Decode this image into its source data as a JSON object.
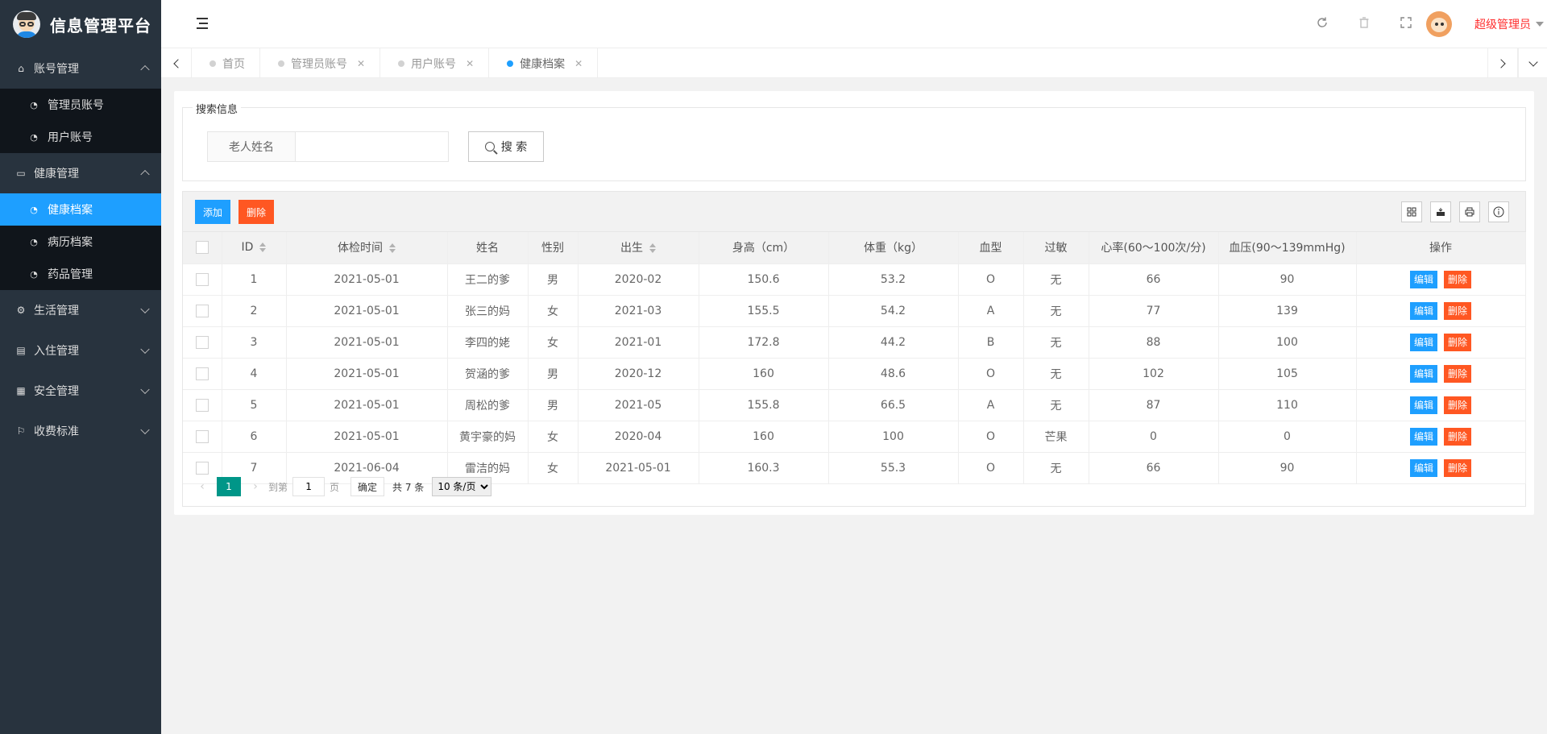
{
  "app": {
    "title": "信息管理平台"
  },
  "sidebar": {
    "groups": [
      {
        "label": "账号管理",
        "icon": "home-icon",
        "expanded": true,
        "items": [
          {
            "label": "管理员账号",
            "icon": "dashboard-icon",
            "active": false
          },
          {
            "label": "用户账号",
            "icon": "dashboard-icon",
            "active": false
          }
        ]
      },
      {
        "label": "健康管理",
        "icon": "window-icon",
        "expanded": true,
        "items": [
          {
            "label": "健康档案",
            "icon": "dashboard-icon",
            "active": true
          },
          {
            "label": "病历档案",
            "icon": "dashboard-icon",
            "active": false
          },
          {
            "label": "药品管理",
            "icon": "dashboard-icon",
            "active": false
          }
        ]
      },
      {
        "label": "生活管理",
        "icon": "gears-icon",
        "expanded": false,
        "items": []
      },
      {
        "label": "入住管理",
        "icon": "file-icon",
        "expanded": false,
        "items": []
      },
      {
        "label": "安全管理",
        "icon": "calendar-icon",
        "expanded": false,
        "items": []
      },
      {
        "label": "收费标准",
        "icon": "flag-icon",
        "expanded": false,
        "items": []
      }
    ]
  },
  "header": {
    "admin_name": "超级管理员",
    "icons": [
      "refresh-icon",
      "trash-icon",
      "fullscreen-icon"
    ]
  },
  "tabs": [
    {
      "label": "首页",
      "closable": false,
      "active": false
    },
    {
      "label": "管理员账号",
      "closable": true,
      "active": false
    },
    {
      "label": "用户账号",
      "closable": true,
      "active": false
    },
    {
      "label": "健康档案",
      "closable": true,
      "active": true
    }
  ],
  "search": {
    "legend": "搜索信息",
    "label": "老人姓名",
    "value": "",
    "placeholder": "",
    "button": "搜 索"
  },
  "toolbar": {
    "add_label": "添加",
    "delete_label": "删除",
    "tools": [
      "columns-icon",
      "export-icon",
      "print-icon",
      "info-icon"
    ]
  },
  "table": {
    "columns": [
      "ID",
      "体检时间",
      "姓名",
      "性别",
      "出生",
      "身高（cm）",
      "体重（kg）",
      "血型",
      "过敏",
      "心率(60～100次/分)",
      "血压(90～139mmHg)",
      "操作"
    ],
    "sortable": [
      true,
      true,
      false,
      false,
      true,
      false,
      false,
      false,
      false,
      false,
      false,
      false
    ],
    "rows": [
      [
        "1",
        "2021-05-01",
        "王二的爹",
        "男",
        "2020-02",
        "150.6",
        "53.2",
        "O",
        "无",
        "66",
        "90"
      ],
      [
        "2",
        "2021-05-01",
        "张三的妈",
        "女",
        "2021-03",
        "155.5",
        "54.2",
        "A",
        "无",
        "77",
        "139"
      ],
      [
        "3",
        "2021-05-01",
        "李四的姥",
        "女",
        "2021-01",
        "172.8",
        "44.2",
        "B",
        "无",
        "88",
        "100"
      ],
      [
        "4",
        "2021-05-01",
        "贺涵的爹",
        "男",
        "2020-12",
        "160",
        "48.6",
        "O",
        "无",
        "102",
        "105"
      ],
      [
        "5",
        "2021-05-01",
        "周松的爹",
        "男",
        "2021-05",
        "155.8",
        "66.5",
        "A",
        "无",
        "87",
        "110"
      ],
      [
        "6",
        "2021-05-01",
        "黄宇豪的妈",
        "女",
        "2020-04",
        "160",
        "100",
        "O",
        "芒果",
        "0",
        "0"
      ],
      [
        "7",
        "2021-06-04",
        "雷洁的妈",
        "女",
        "2021-05-01",
        "160.3",
        "55.3",
        "O",
        "无",
        "66",
        "90"
      ]
    ],
    "row_actions": {
      "edit": "编辑",
      "delete": "删除"
    }
  },
  "pager": {
    "current": "1",
    "goto_prefix": "到第",
    "goto_value": "1",
    "goto_suffix": "页",
    "confirm": "确定",
    "total": "共 7 条",
    "page_size": "10 条/页"
  }
}
